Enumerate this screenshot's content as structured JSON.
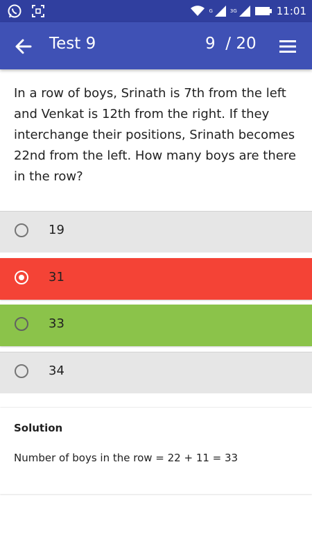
{
  "status_bar": {
    "left_icons": [
      "whatsapp-icon",
      "screenshot-icon"
    ],
    "right_icons": [
      "wifi-icon",
      "signal-icon",
      "signal-3g-icon",
      "battery-icon"
    ],
    "network_label_1": "G",
    "network_label_2": "3G",
    "time": "11:01"
  },
  "app_bar": {
    "title": "Test 9",
    "counter": "9  / 20",
    "back_icon": "arrow-back-icon",
    "menu_icon": "menu-icon",
    "background": "#3f51b5"
  },
  "question": {
    "text": "In a row of boys, Srinath is 7th from the left and Venkat is 12th from the right. If they interchange their positions, Srinath becomes 22nd from the left. How many boys are there in the row?"
  },
  "options": [
    {
      "label": "19",
      "state": "default",
      "selected": false
    },
    {
      "label": "31",
      "state": "wrong",
      "selected": true
    },
    {
      "label": "33",
      "state": "correct",
      "selected": false
    },
    {
      "label": "34",
      "state": "default",
      "selected": false
    }
  ],
  "colors": {
    "wrong": "#f44336",
    "correct": "#8bc34a",
    "default": "#e6e6e6"
  },
  "solution": {
    "title": "Solution",
    "text": "Number of boys in the row = 22 + 11 = 33"
  }
}
